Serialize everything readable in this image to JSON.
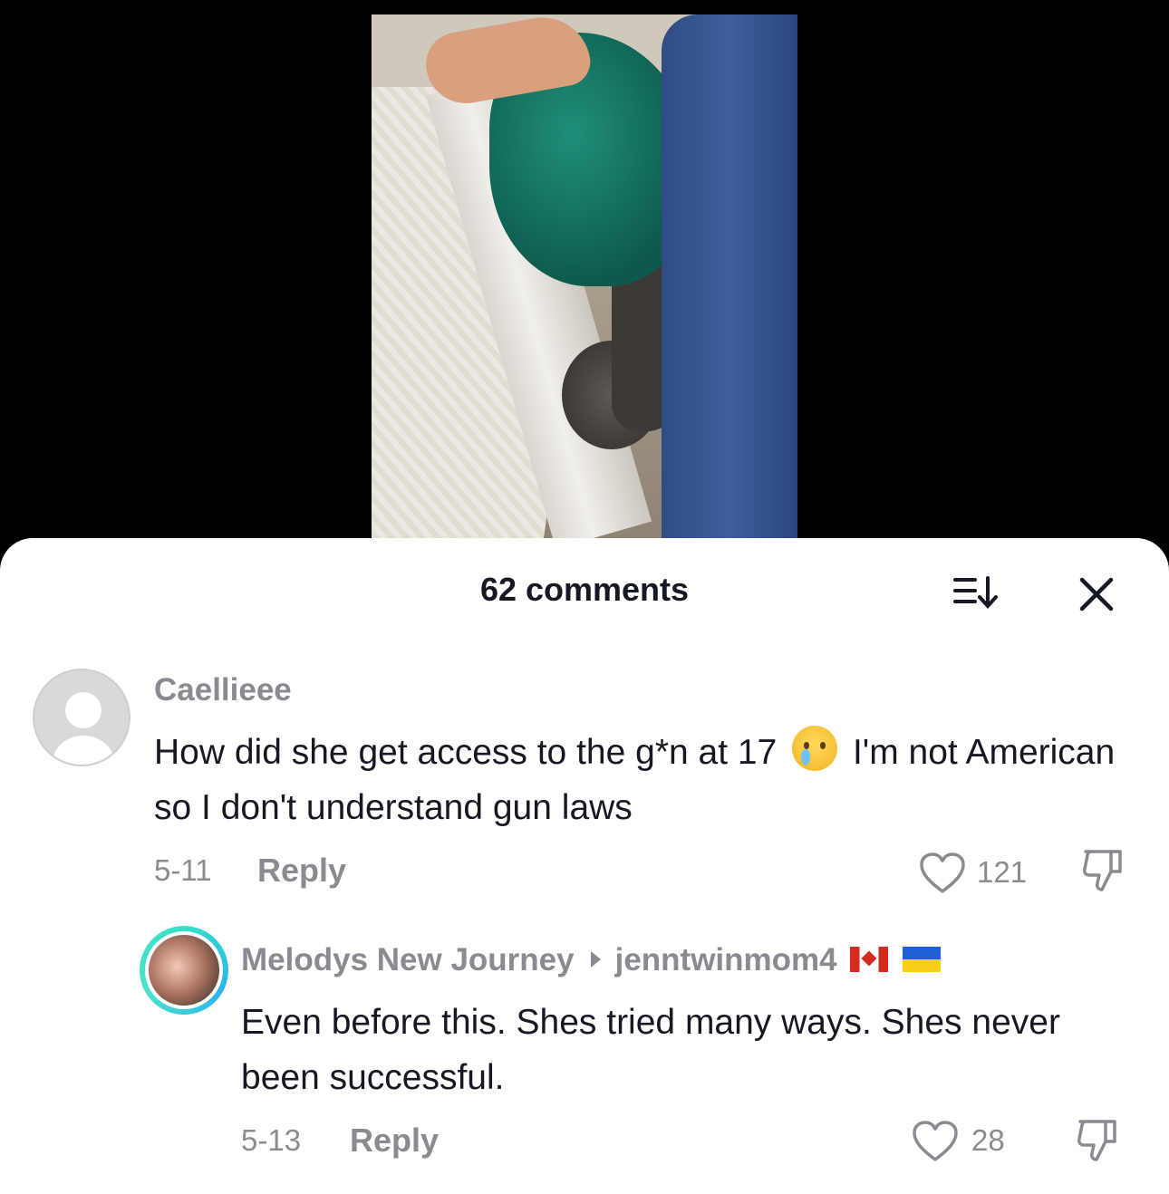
{
  "sheet": {
    "comments_count": "62 comments"
  },
  "icons": {
    "sort": "sort-descending-icon",
    "close": "close-icon",
    "like": "heart-outline-icon",
    "dislike": "thumbs-down-icon"
  },
  "comments": [
    {
      "username": "Caellieee",
      "text_before_emoji": "How did she get access to the g*n at 17",
      "text_after_emoji": " I'm not American so I don't understand gun laws",
      "date": "5-11",
      "reply_label": "Reply",
      "likes": "121"
    },
    {
      "username": "Melodys New Journey",
      "reply_to": "jenntwinmom4",
      "text": "Even before this. Shes tried many ways. Shes never been successful.",
      "date": "5-13",
      "reply_label": "Reply",
      "likes": "28"
    }
  ],
  "colors": {
    "text_primary": "#161823",
    "text_secondary": "#8a8b91",
    "story_ring": "#35e0c8"
  }
}
